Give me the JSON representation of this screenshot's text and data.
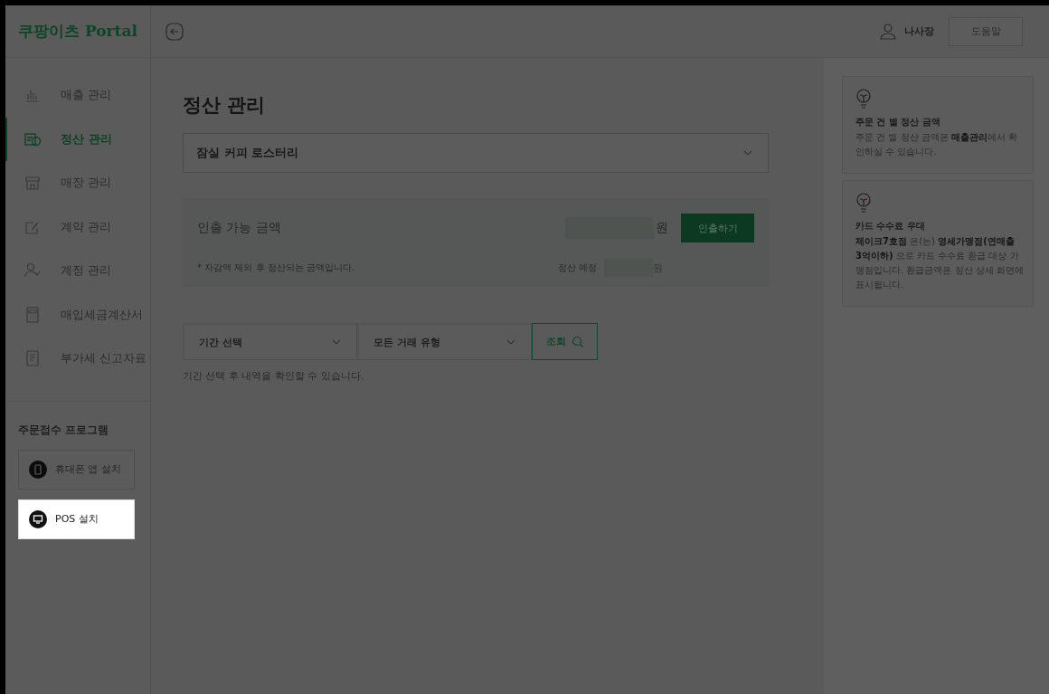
{
  "sidebar": {
    "logo": "쿠팡이츠 Portal",
    "items": [
      {
        "label": "매출 관리",
        "selected": false
      },
      {
        "label": "정산 관리",
        "selected": true
      },
      {
        "label": "매장 관리",
        "selected": false
      },
      {
        "label": "계약 관리",
        "selected": false
      },
      {
        "label": "계정 관리",
        "selected": false
      },
      {
        "label": "매입세금계산서",
        "selected": false
      },
      {
        "label": "부가세 신고자료",
        "selected": false
      }
    ],
    "section_title": "주문접수 프로그램",
    "installs": [
      {
        "label": "휴대폰 앱 설치",
        "highlighted": false
      },
      {
        "label": "POS 설치",
        "highlighted": true
      }
    ]
  },
  "header": {
    "user_name": "나사장",
    "help_button": "도움말"
  },
  "page_title": "정산 관리",
  "store_select": "잠실 커피 로스터리",
  "withdrawal": {
    "label": "인출 가능 금액",
    "currency": "원",
    "button": "인출하기",
    "note": "* 차감액 제외 후 정산되는 금액입니다.",
    "scheduled_label": "정산 예정",
    "scheduled_currency": "원"
  },
  "filters": {
    "period": "기간 선택",
    "type": "모든 거래 유형",
    "search_button": "조회",
    "hint": "기간 선택 후 내역을 확인할 수 있습니다."
  },
  "tips": [
    {
      "title": "주문 건 별 정산 금액",
      "body": "주문 건 별 정산 금액은 **매출관리**에서 확인하실 수 있습니다."
    },
    {
      "title": "카드 수수료 우대",
      "body": "**제이크7호점** 은(는) **영세가맹점(연매출 3억이하)** 으로 카드 수수료 환급 대상 가맹점입니다. 환급금액은 정산 상세 화면에 표시됩니다."
    }
  ]
}
